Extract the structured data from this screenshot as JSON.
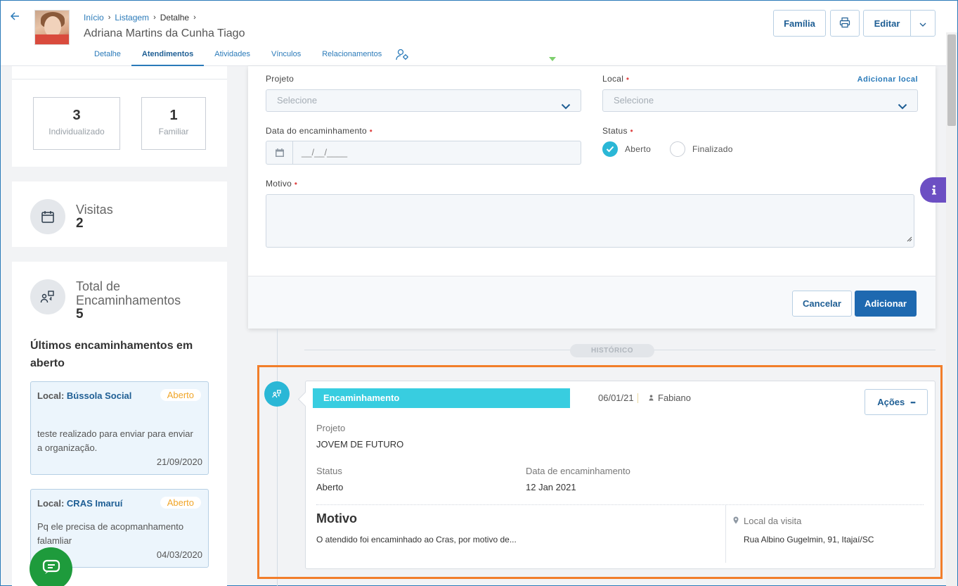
{
  "header": {
    "breadcrumb": [
      "Início",
      "Listagem",
      "Detalhe"
    ],
    "person_name": "Adriana Martins da Cunha Tiago",
    "tabs": [
      "Detalhe",
      "Atendimentos",
      "Atividades",
      "Vínculos",
      "Relacionamentos"
    ],
    "active_tab": "Atendimentos",
    "buttons": {
      "family": "Família",
      "edit": "Editar"
    }
  },
  "sidebar": {
    "individualizado": {
      "count": "3",
      "label": "Individualizado"
    },
    "familiar": {
      "count": "1",
      "label": "Familiar"
    },
    "visitas": {
      "title": "Visitas",
      "count": "2"
    },
    "total_encaminhamentos": {
      "title_line1": "Total de",
      "title_line2": "Encaminhamentos",
      "count": "5"
    },
    "ultimos_title": "Últimos encaminhamentos em aberto",
    "items": [
      {
        "local_prefix": "Local:",
        "local_name": "Bússola Social",
        "status": "Aberto",
        "description": "teste realizado para enviar para enviar a organização.",
        "date": "21/09/2020"
      },
      {
        "local_prefix": "Local:",
        "local_name": "CRAS Imaruí",
        "status": "Aberto",
        "description": "Pq ele precisa de acopmanhamento falamliar",
        "date": "04/03/2020"
      }
    ]
  },
  "form": {
    "projeto_label": "Projeto",
    "projeto_placeholder": "Selecione",
    "local_label": "Local",
    "local_placeholder": "Selecione",
    "add_local_link": "Adicionar local",
    "data_label": "Data do encaminhamento",
    "data_mask": "__/__/____",
    "status_label": "Status",
    "status_options": [
      "Aberto",
      "Finalizado"
    ],
    "status_selected": "Aberto",
    "motivo_label": "Motivo",
    "required_mark": "•",
    "cancel": "Cancelar",
    "submit": "Adicionar"
  },
  "history": {
    "label": "HISTÓRICO",
    "event": {
      "type": "Encaminhamento",
      "date": "06/01/21",
      "user": "Fabiano",
      "actions": "Ações",
      "actions_dots": "•••",
      "projeto_label": "Projeto",
      "projeto_value": "JOVEM DE FUTURO",
      "status_label": "Status",
      "status_value": "Aberto",
      "data_label": "Data de encaminhamento",
      "data_value": "12 Jan 2021",
      "motivo_title": "Motivo",
      "motivo_text": "O atendido foi encaminhado ao Cras, por motivo de...",
      "local_label": "Local da visita",
      "local_value": "Rua Albino Gugelmin, 91, Itajaí/SC"
    }
  },
  "colors": {
    "primary": "#1e69b0",
    "accent_cyan": "#38cde0",
    "highlight": "#f27e2a",
    "chat": "#1e9b3c",
    "info": "#6c4fc3"
  }
}
